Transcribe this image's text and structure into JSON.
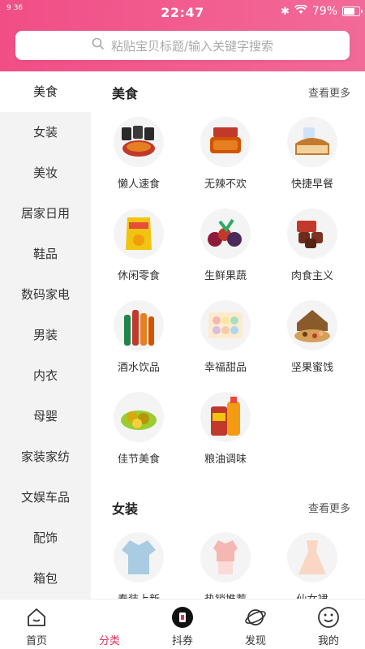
{
  "status": {
    "signal": "9 36",
    "time": "22:47",
    "battery": "79%",
    "battery_level": 0.79
  },
  "search": {
    "placeholder": "粘贴宝贝标题/输入关键字搜索",
    "icon": "search-icon"
  },
  "sidebar": {
    "items": [
      {
        "label": "美食",
        "active": true
      },
      {
        "label": "女装"
      },
      {
        "label": "美妆"
      },
      {
        "label": "居家日用"
      },
      {
        "label": "鞋品"
      },
      {
        "label": "数码家电"
      },
      {
        "label": "男装"
      },
      {
        "label": "内衣"
      },
      {
        "label": "母婴"
      },
      {
        "label": "家装家纺"
      },
      {
        "label": "文娱车品"
      },
      {
        "label": "配饰"
      },
      {
        "label": "箱包"
      }
    ]
  },
  "sections": [
    {
      "title": "美食",
      "more": "查看更多",
      "items": [
        {
          "label": "懒人速食",
          "icon": "noodles-icon"
        },
        {
          "label": "无辣不欢",
          "icon": "spicy-meat-icon"
        },
        {
          "label": "快捷早餐",
          "icon": "bread-icon"
        },
        {
          "label": "休闲零食",
          "icon": "chips-icon"
        },
        {
          "label": "生鲜果蔬",
          "icon": "fruit-icon"
        },
        {
          "label": "肉食主义",
          "icon": "meat-icon"
        },
        {
          "label": "酒水饮品",
          "icon": "drinks-icon"
        },
        {
          "label": "幸福甜品",
          "icon": "macaron-icon"
        },
        {
          "label": "坚果蜜饯",
          "icon": "nuts-icon"
        },
        {
          "label": "佳节美食",
          "icon": "zongzi-icon"
        },
        {
          "label": "粮油调味",
          "icon": "oil-icon"
        }
      ]
    },
    {
      "title": "女装",
      "more": "查看更多",
      "items": [
        {
          "label": "春装上新",
          "icon": "blouse-icon"
        },
        {
          "label": "热销推荐",
          "icon": "outfit-icon"
        },
        {
          "label": "仙女裙",
          "icon": "dress-icon"
        }
      ]
    }
  ],
  "tabbar": [
    {
      "label": "首页",
      "icon": "home-icon"
    },
    {
      "label": "分类",
      "icon": "category-icon",
      "active": true
    },
    {
      "label": "抖券",
      "icon": "douyin-icon"
    },
    {
      "label": "发现",
      "icon": "planet-icon"
    },
    {
      "label": "我的",
      "icon": "smile-icon"
    }
  ],
  "colors": {
    "brand": "#f14e86",
    "active_tab": "#e2305d"
  }
}
